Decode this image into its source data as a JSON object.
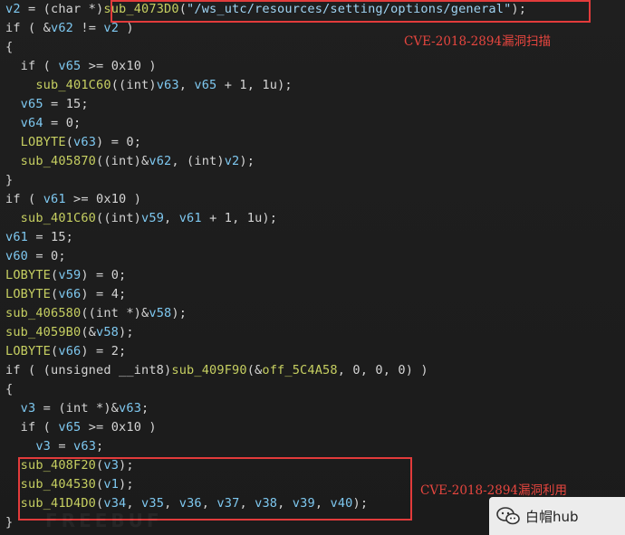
{
  "code_lines": [
    [
      {
        "t": "v2",
        "c": "var"
      },
      {
        "t": " = (char *)",
        "c": "plain"
      },
      {
        "t": "sub_4073D0",
        "c": "func"
      },
      {
        "t": "(",
        "c": "plain"
      },
      {
        "t": "\"/ws_utc/resources/setting/options/general\"",
        "c": "str"
      },
      {
        "t": ");",
        "c": "plain"
      }
    ],
    [
      {
        "t": "if",
        "c": "key"
      },
      {
        "t": " ( &",
        "c": "plain"
      },
      {
        "t": "v62",
        "c": "var"
      },
      {
        "t": " != ",
        "c": "plain"
      },
      {
        "t": "v2",
        "c": "var"
      },
      {
        "t": " )",
        "c": "plain"
      }
    ],
    [
      {
        "t": "{",
        "c": "plain"
      }
    ],
    [
      {
        "t": "  if",
        "c": "key"
      },
      {
        "t": " ( ",
        "c": "plain"
      },
      {
        "t": "v65",
        "c": "var"
      },
      {
        "t": " >= 0x10 )",
        "c": "plain"
      }
    ],
    [
      {
        "t": "    ",
        "c": "plain"
      },
      {
        "t": "sub_401C60",
        "c": "func"
      },
      {
        "t": "((int)",
        "c": "plain"
      },
      {
        "t": "v63",
        "c": "var"
      },
      {
        "t": ", ",
        "c": "plain"
      },
      {
        "t": "v65",
        "c": "var"
      },
      {
        "t": " + 1, 1u);",
        "c": "plain"
      }
    ],
    [
      {
        "t": "  ",
        "c": "plain"
      },
      {
        "t": "v65",
        "c": "var"
      },
      {
        "t": " = 15;",
        "c": "plain"
      }
    ],
    [
      {
        "t": "  ",
        "c": "plain"
      },
      {
        "t": "v64",
        "c": "var"
      },
      {
        "t": " = 0;",
        "c": "plain"
      }
    ],
    [
      {
        "t": "  ",
        "c": "plain"
      },
      {
        "t": "LOBYTE",
        "c": "func"
      },
      {
        "t": "(",
        "c": "plain"
      },
      {
        "t": "v63",
        "c": "var"
      },
      {
        "t": ") = 0;",
        "c": "plain"
      }
    ],
    [
      {
        "t": "  ",
        "c": "plain"
      },
      {
        "t": "sub_405870",
        "c": "func"
      },
      {
        "t": "((int)&",
        "c": "plain"
      },
      {
        "t": "v62",
        "c": "var"
      },
      {
        "t": ", (int)",
        "c": "plain"
      },
      {
        "t": "v2",
        "c": "var"
      },
      {
        "t": ");",
        "c": "plain"
      }
    ],
    [
      {
        "t": "}",
        "c": "plain"
      }
    ],
    [
      {
        "t": "if",
        "c": "key"
      },
      {
        "t": " ( ",
        "c": "plain"
      },
      {
        "t": "v61",
        "c": "var"
      },
      {
        "t": " >= 0x10 )",
        "c": "plain"
      }
    ],
    [
      {
        "t": "  ",
        "c": "plain"
      },
      {
        "t": "sub_401C60",
        "c": "func"
      },
      {
        "t": "((int)",
        "c": "plain"
      },
      {
        "t": "v59",
        "c": "var"
      },
      {
        "t": ", ",
        "c": "plain"
      },
      {
        "t": "v61",
        "c": "var"
      },
      {
        "t": " + 1, 1u);",
        "c": "plain"
      }
    ],
    [
      {
        "t": "v61",
        "c": "var"
      },
      {
        "t": " = 15;",
        "c": "plain"
      }
    ],
    [
      {
        "t": "v60",
        "c": "var"
      },
      {
        "t": " = 0;",
        "c": "plain"
      }
    ],
    [
      {
        "t": "LOBYTE",
        "c": "func"
      },
      {
        "t": "(",
        "c": "plain"
      },
      {
        "t": "v59",
        "c": "var"
      },
      {
        "t": ") = 0;",
        "c": "plain"
      }
    ],
    [
      {
        "t": "LOBYTE",
        "c": "func"
      },
      {
        "t": "(",
        "c": "plain"
      },
      {
        "t": "v66",
        "c": "var"
      },
      {
        "t": ") = 4;",
        "c": "plain"
      }
    ],
    [
      {
        "t": "sub_406580",
        "c": "func"
      },
      {
        "t": "((int *)&",
        "c": "plain"
      },
      {
        "t": "v58",
        "c": "var"
      },
      {
        "t": ");",
        "c": "plain"
      }
    ],
    [
      {
        "t": "sub_4059B0",
        "c": "func"
      },
      {
        "t": "(&",
        "c": "plain"
      },
      {
        "t": "v58",
        "c": "var"
      },
      {
        "t": ");",
        "c": "plain"
      }
    ],
    [
      {
        "t": "LOBYTE",
        "c": "func"
      },
      {
        "t": "(",
        "c": "plain"
      },
      {
        "t": "v66",
        "c": "var"
      },
      {
        "t": ") = 2;",
        "c": "plain"
      }
    ],
    [
      {
        "t": "if",
        "c": "key"
      },
      {
        "t": " ( (unsigned __int8)",
        "c": "plain"
      },
      {
        "t": "sub_409F90",
        "c": "func"
      },
      {
        "t": "(&",
        "c": "plain"
      },
      {
        "t": "off_5C4A58",
        "c": "func"
      },
      {
        "t": ", 0, 0, 0) )",
        "c": "plain"
      }
    ],
    [
      {
        "t": "{",
        "c": "plain"
      }
    ],
    [
      {
        "t": "  ",
        "c": "plain"
      },
      {
        "t": "v3",
        "c": "var"
      },
      {
        "t": " = (int *)&",
        "c": "plain"
      },
      {
        "t": "v63",
        "c": "var"
      },
      {
        "t": ";",
        "c": "plain"
      }
    ],
    [
      {
        "t": "  if",
        "c": "key"
      },
      {
        "t": " ( ",
        "c": "plain"
      },
      {
        "t": "v65",
        "c": "var"
      },
      {
        "t": " >= 0x10 )",
        "c": "plain"
      }
    ],
    [
      {
        "t": "    ",
        "c": "plain"
      },
      {
        "t": "v3",
        "c": "var"
      },
      {
        "t": " = ",
        "c": "plain"
      },
      {
        "t": "v63",
        "c": "var"
      },
      {
        "t": ";",
        "c": "plain"
      }
    ],
    [
      {
        "t": "  ",
        "c": "plain"
      },
      {
        "t": "sub_408F20",
        "c": "func"
      },
      {
        "t": "(",
        "c": "plain"
      },
      {
        "t": "v3",
        "c": "var"
      },
      {
        "t": ");",
        "c": "plain"
      }
    ],
    [
      {
        "t": "  ",
        "c": "plain"
      },
      {
        "t": "sub_404530",
        "c": "func"
      },
      {
        "t": "(",
        "c": "plain"
      },
      {
        "t": "v1",
        "c": "var"
      },
      {
        "t": ");",
        "c": "plain"
      }
    ],
    [
      {
        "t": "  ",
        "c": "plain"
      },
      {
        "t": "sub_41D4D0",
        "c": "func"
      },
      {
        "t": "(",
        "c": "plain"
      },
      {
        "t": "v34",
        "c": "var"
      },
      {
        "t": ", ",
        "c": "plain"
      },
      {
        "t": "v35",
        "c": "var"
      },
      {
        "t": ", ",
        "c": "plain"
      },
      {
        "t": "v36",
        "c": "var"
      },
      {
        "t": ", ",
        "c": "plain"
      },
      {
        "t": "v37",
        "c": "var"
      },
      {
        "t": ", ",
        "c": "plain"
      },
      {
        "t": "v38",
        "c": "var"
      },
      {
        "t": ", ",
        "c": "plain"
      },
      {
        "t": "v39",
        "c": "var"
      },
      {
        "t": ", ",
        "c": "plain"
      },
      {
        "t": "v40",
        "c": "var"
      },
      {
        "t": ");",
        "c": "plain"
      }
    ],
    [
      {
        "t": "}",
        "c": "plain"
      }
    ]
  ],
  "annotations": {
    "scan": "CVE-2018-2894漏洞扫描",
    "exploit": "CVE-2018-2894漏洞利用"
  },
  "watermark": {
    "icon": "wechat-icon",
    "text": "白帽hub"
  },
  "colors": {
    "background": "#1c1c1c",
    "variable": "#7ec8f0",
    "function": "#c6cf61",
    "plain": "#d4d4d4",
    "highlight_box": "#e23b3b"
  }
}
